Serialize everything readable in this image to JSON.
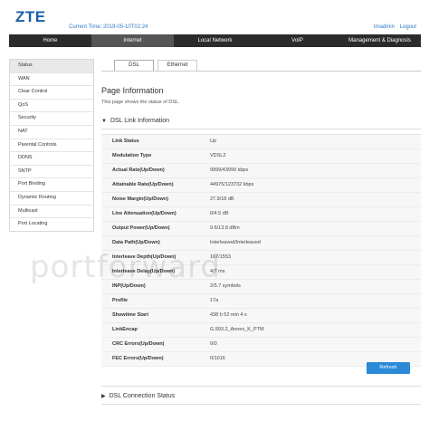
{
  "header": {
    "logo": "ZTE",
    "current_time": "Current Time: 2019-05-10T02:24",
    "username": "tmadmin",
    "logout": "Logout"
  },
  "topnav": [
    "Home",
    "Internet",
    "Local Network",
    "VoIP",
    "Management & Diagnosis"
  ],
  "sidebar": [
    "Status",
    "WAN",
    "Clear Control",
    "QoS",
    "Security",
    "NAT",
    "Parental Controls",
    "DDNS",
    "SNTP",
    "Port Binding",
    "Dynamic Routing",
    "Multicast",
    "Port Locating"
  ],
  "tabs": [
    "DSL",
    "Ethernet"
  ],
  "page": {
    "title": "Page Information",
    "desc": "This page shows the status of DSL.",
    "section1": "DSL Link Information",
    "section2": "DSL Connection Status"
  },
  "rows": [
    {
      "label": "Link Status",
      "value": "Up"
    },
    {
      "label": "Modulation Type",
      "value": "VDSL2"
    },
    {
      "label": "Actual Rate(Up/Down)",
      "value": "9999/43999 kbps"
    },
    {
      "label": "Attainable Rate(Up/Down)",
      "value": "44975/123732 kbps"
    },
    {
      "label": "Noise Margin(Up/Down)",
      "value": "27.9/18 dB"
    },
    {
      "label": "Line Attenuation(Up/Down)",
      "value": "0/4.5 dB"
    },
    {
      "label": "Output Power(Up/Down)",
      "value": "9.6/13.8 dBm"
    },
    {
      "label": "Data Path(Up/Down)",
      "value": "Interleaved/Interleaved"
    },
    {
      "label": "Interleave Depth(Up/Down)",
      "value": "167/1553"
    },
    {
      "label": "Interleave Delay(Up/Down)",
      "value": "4/7 ms"
    },
    {
      "label": "INP(Up/Down)",
      "value": "2/5.7 symbols"
    },
    {
      "label": "Profile",
      "value": "17a"
    },
    {
      "label": "Showtime Start",
      "value": "438 h 52 min 4 s"
    },
    {
      "label": "LinkEncap",
      "value": "G.993.2_Annex_K_PTM"
    },
    {
      "label": "CRC Errors(Up/Down)",
      "value": "0/0"
    },
    {
      "label": "FEC Errors(Up/Down)",
      "value": "0/1016"
    }
  ],
  "refresh_label": "Refresh",
  "watermark": "portforward",
  "colors": {
    "accent": "#2b8ad8",
    "nav_bg": "#2b2b2b",
    "logo": "#1a5fa8"
  }
}
